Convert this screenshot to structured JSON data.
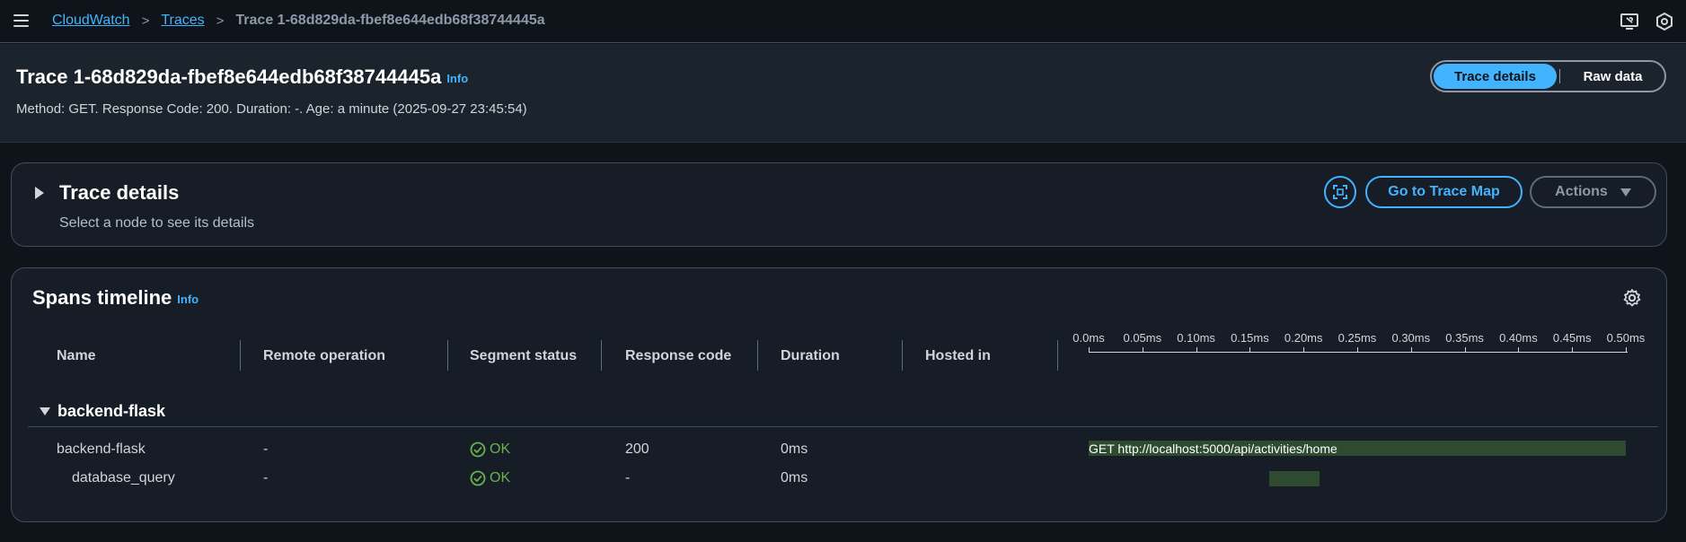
{
  "breadcrumb": {
    "root": "CloudWatch",
    "section": "Traces",
    "current": "Trace 1-68d829da-fbef8e644edb68f38744445a"
  },
  "header": {
    "title": "Trace 1-68d829da-fbef8e644edb68f38744445a",
    "info": "Info",
    "meta": "Method: GET. Response Code: 200. Duration: -. Age: a minute (2025-09-27 23:45:54)",
    "tabs": [
      "Trace details",
      "Raw data"
    ],
    "active_tab": "Trace details"
  },
  "details_panel": {
    "title": "Trace details",
    "subtitle": "Select a node to see its details",
    "go_to_map": "Go to Trace Map",
    "actions": "Actions"
  },
  "spans_panel": {
    "title": "Spans timeline",
    "info": "Info",
    "columns": [
      "Name",
      "Remote operation",
      "Segment status",
      "Response code",
      "Duration",
      "Hosted in"
    ],
    "ticks": [
      "0.0ms",
      "0.05ms",
      "0.10ms",
      "0.15ms",
      "0.20ms",
      "0.25ms",
      "0.30ms",
      "0.35ms",
      "0.40ms",
      "0.45ms",
      "0.50ms"
    ],
    "group": "backend-flask",
    "rows": [
      {
        "name": "backend-flask",
        "remote_op": "-",
        "status": "OK",
        "response": "200",
        "duration": "0ms",
        "hosted": "",
        "bar_label": "GET http://localhost:5000/api/activities/home",
        "bar_start": 0.0,
        "bar_end": 0.5
      },
      {
        "name": "database_query",
        "remote_op": "-",
        "status": "OK",
        "response": "-",
        "duration": "0ms",
        "hosted": "",
        "bar_label": "",
        "bar_start": 0.168,
        "bar_end": 0.215
      }
    ]
  },
  "colors": {
    "accent": "#42b4ff",
    "ok": "#6ab04c",
    "span_bar": "#2f4b2f"
  }
}
